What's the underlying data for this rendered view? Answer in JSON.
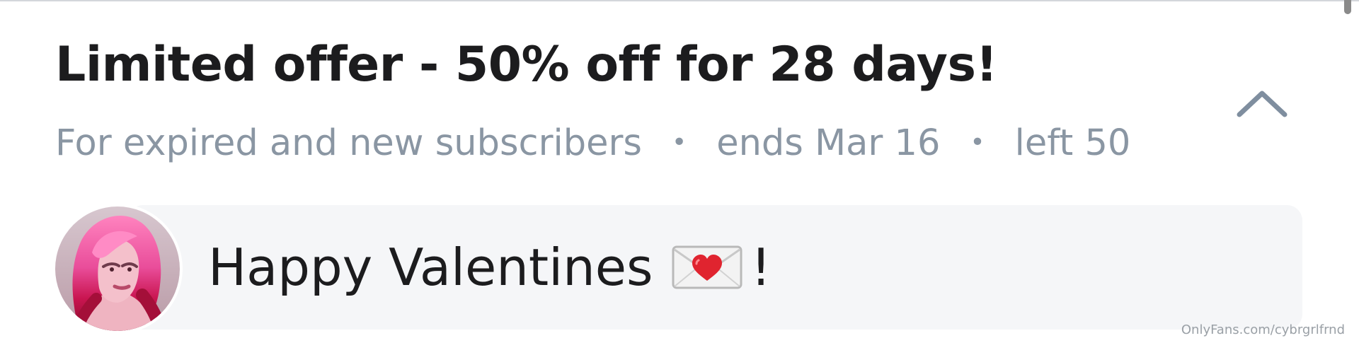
{
  "offer": {
    "title": "Limited offer - 50% off for 28 days!",
    "audience": "For expired and new subscribers",
    "ends": "ends Mar 16",
    "remaining": "left 50",
    "separator": "•",
    "collapse_icon": "chevron-up-icon"
  },
  "message": {
    "text_before": "Happy Valentines",
    "emoji_icon": "love-letter-icon",
    "text_after": "!",
    "avatar_icon": "avatar"
  },
  "watermark": "OnlyFans.com/cybrgrlfrnd",
  "colors": {
    "title": "#1c1c1e",
    "meta": "#8a96a3",
    "card_background": "#f5f6f8",
    "accent_heart": "#e0242f"
  }
}
